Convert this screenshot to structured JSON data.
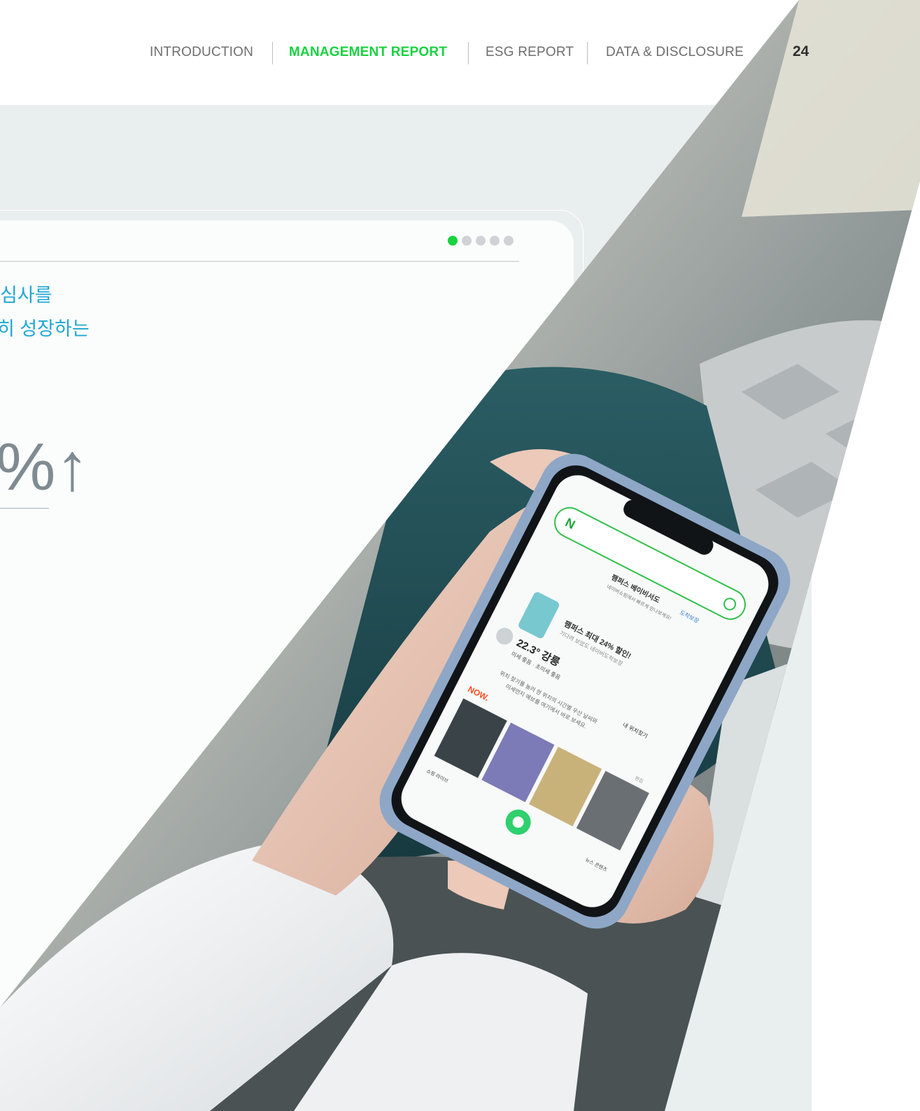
{
  "nav": {
    "items": [
      {
        "label": "INTRODUCTION"
      },
      {
        "label": "MANAGEMENT REPORT"
      },
      {
        "label": "ESG REPORT"
      },
      {
        "label": "DATA & DISCLOSURE"
      }
    ],
    "active_index": 1,
    "page_number": "24"
  },
  "colors": {
    "accent_green": "#17d33f",
    "headline_blue": "#20a7d4",
    "band_grey": "#e9eeef"
  },
  "card": {
    "pager": {
      "total": 5,
      "active": 0
    },
    "headline_line1": "심사를",
    "headline_line2": "히 성장하는",
    "stat_suffix": "%↑"
  },
  "phone_screen": {
    "promo_line1": "팸퍼스 베이비서도",
    "promo_line2": "네이버쇼핑에서 빠르게 만나보세요!",
    "promo_tag": "도착보장",
    "deal_title": "팸퍼스 최대 24% 할인!",
    "deal_sub": "기다려 보았도 네이버도착보장",
    "weather_temp": "22.3° 강릉",
    "weather_dust": "미세 좋음 · 초미세 좋음",
    "widget_text1": "위치 찾기를 눌러 현 위치의 시간별 우산 날씨와",
    "widget_text2": "미세먼지 예보를 여기에서 바로 보세요.",
    "widget_link": "내 위치찾기",
    "now_label": "NOW.",
    "edit_label": "편집",
    "bottom_left": "쇼핑 라이브",
    "bottom_right": "뉴스 콘텐츠"
  }
}
